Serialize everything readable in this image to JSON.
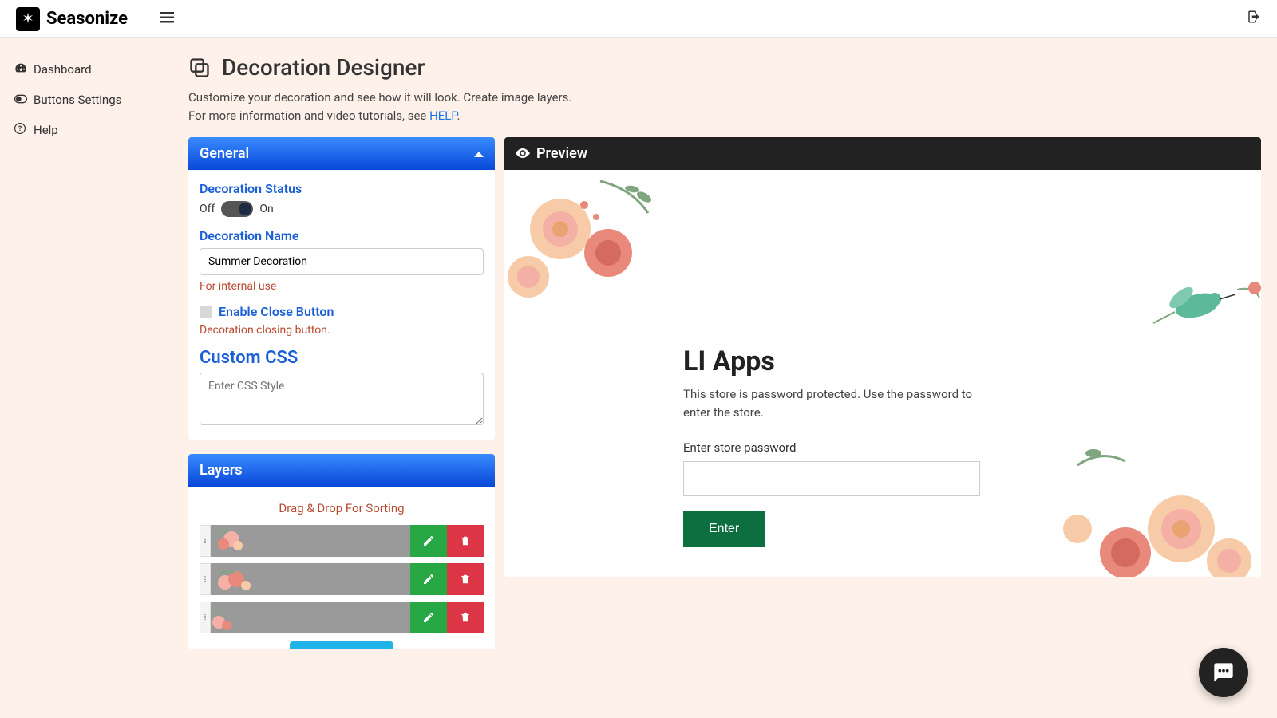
{
  "header": {
    "brand": "Seasonize"
  },
  "sidebar": {
    "items": [
      {
        "label": "Dashboard"
      },
      {
        "label": "Buttons Settings"
      },
      {
        "label": "Help"
      }
    ]
  },
  "page": {
    "title": "Decoration Designer",
    "subtitle_line1": "Customize your decoration and see how it will look. Create image layers.",
    "subtitle_line2_pre": "For more information and video tutorials, see ",
    "subtitle_help": "HELP",
    "subtitle_line2_post": "."
  },
  "general": {
    "panel_title": "General",
    "status_label": "Decoration Status",
    "off_label": "Off",
    "on_label": "On",
    "name_label": "Decoration Name",
    "name_value": "Summer Decoration",
    "name_hint": "For internal use",
    "close_btn_label": "Enable Close Button",
    "close_btn_hint": "Decoration closing button.",
    "css_label": "Custom CSS",
    "css_placeholder": "Enter CSS Style"
  },
  "layers": {
    "panel_title": "Layers",
    "hint": "Drag & Drop For Sorting"
  },
  "preview": {
    "panel_title": "Preview",
    "store_title": "LI Apps",
    "store_subtitle": "This store is password protected. Use the password to enter the store.",
    "pw_label": "Enter store password",
    "enter_btn": "Enter"
  }
}
